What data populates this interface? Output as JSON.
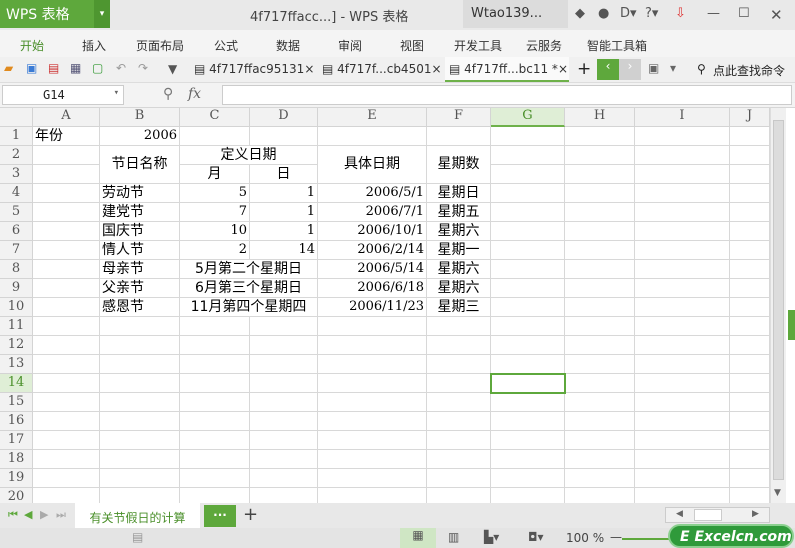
{
  "app": {
    "name": "WPS 表格",
    "doc_title": "4f717ffacc...] - WPS 表格",
    "user": "Wtao139..."
  },
  "menu": [
    "开始",
    "插入",
    "页面布局",
    "公式",
    "数据",
    "审阅",
    "视图",
    "开发工具",
    "云服务",
    "智能工具箱"
  ],
  "doc_tabs": [
    {
      "label": "4f717ffac95131",
      "active": false
    },
    {
      "label": "4f717f...cb4501",
      "active": false
    },
    {
      "label": "4f717ff...bc11 *",
      "active": true
    }
  ],
  "search_command": "点此查找命令",
  "name_box": "G14",
  "fx": "fx",
  "formula": "",
  "columns": [
    "A",
    "B",
    "C",
    "D",
    "E",
    "F",
    "G",
    "H",
    "I",
    "J"
  ],
  "rows": [
    "1",
    "2",
    "3",
    "4",
    "5",
    "6",
    "7",
    "8",
    "9",
    "10",
    "11",
    "12",
    "13",
    "14",
    "15",
    "16",
    "17",
    "18",
    "19",
    "20"
  ],
  "cells": [
    {
      "ref": "A1",
      "text": "年份"
    },
    {
      "ref": "B1",
      "text": "2006",
      "num": true
    },
    {
      "ref": "B2",
      "text": "节日名称",
      "span": "B2:B3",
      "center": true
    },
    {
      "ref": "C2",
      "text": "定义日期",
      "span": "C2:D2",
      "center": true
    },
    {
      "ref": "C3",
      "text": "月",
      "center": true
    },
    {
      "ref": "D3",
      "text": "日",
      "center": true
    },
    {
      "ref": "E2",
      "text": "具体日期",
      "span": "E2:E3",
      "center": true
    },
    {
      "ref": "F2",
      "text": "星期数",
      "span": "F2:F3",
      "center": true
    },
    {
      "ref": "B4",
      "text": "劳动节"
    },
    {
      "ref": "C4",
      "text": "5",
      "num": true
    },
    {
      "ref": "D4",
      "text": "1",
      "num": true
    },
    {
      "ref": "E4",
      "text": "2006/5/1",
      "num": true
    },
    {
      "ref": "F4",
      "text": "星期日",
      "center": true
    },
    {
      "ref": "B5",
      "text": "建党节"
    },
    {
      "ref": "C5",
      "text": "7",
      "num": true
    },
    {
      "ref": "D5",
      "text": "1",
      "num": true
    },
    {
      "ref": "E5",
      "text": "2006/7/1",
      "num": true
    },
    {
      "ref": "F5",
      "text": "星期五",
      "center": true
    },
    {
      "ref": "B6",
      "text": "国庆节"
    },
    {
      "ref": "C6",
      "text": "10",
      "num": true
    },
    {
      "ref": "D6",
      "text": "1",
      "num": true
    },
    {
      "ref": "E6",
      "text": "2006/10/1",
      "num": true
    },
    {
      "ref": "F6",
      "text": "星期六",
      "center": true
    },
    {
      "ref": "B7",
      "text": "情人节"
    },
    {
      "ref": "C7",
      "text": "2",
      "num": true
    },
    {
      "ref": "D7",
      "text": "14",
      "num": true
    },
    {
      "ref": "E7",
      "text": "2006/2/14",
      "num": true
    },
    {
      "ref": "F7",
      "text": "星期一",
      "center": true
    },
    {
      "ref": "B8",
      "text": "母亲节"
    },
    {
      "ref": "C8",
      "text": "5月第二个星期日",
      "span": "C8:D8",
      "center": true
    },
    {
      "ref": "E8",
      "text": "2006/5/14",
      "num": true
    },
    {
      "ref": "F8",
      "text": "星期六",
      "center": true
    },
    {
      "ref": "B9",
      "text": "父亲节"
    },
    {
      "ref": "C9",
      "text": "6月第三个星期日",
      "span": "C9:D9",
      "center": true
    },
    {
      "ref": "E9",
      "text": "2006/6/18",
      "num": true
    },
    {
      "ref": "F9",
      "text": "星期六",
      "center": true
    },
    {
      "ref": "B10",
      "text": "感恩节"
    },
    {
      "ref": "C10",
      "text": "11月第四个星期四",
      "span": "C10:D10",
      "center": true
    },
    {
      "ref": "E10",
      "text": "2006/11/23",
      "num": true
    },
    {
      "ref": "F10",
      "text": "星期三",
      "center": true
    }
  ],
  "selected_cell": "G14",
  "sheet_tab": "有关节假日的计算",
  "more_tabs": "···",
  "add_sheet": "+",
  "zoom": "100 %",
  "watermark": "Excelcn.com"
}
